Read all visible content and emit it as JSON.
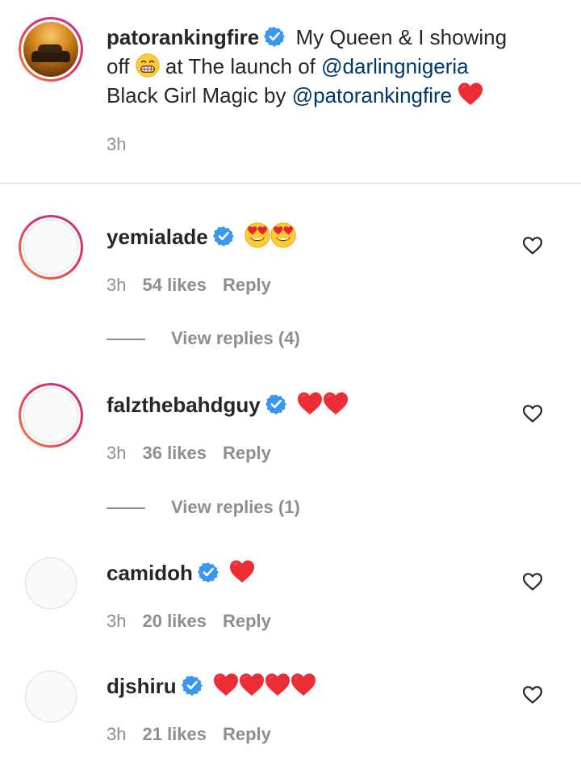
{
  "caption": {
    "username": "patorankingfire",
    "line1_text": "My Queen & I showing",
    "line2_a": "off",
    "line2_b": "at The launch of",
    "mention1": "@darlingnigeria",
    "line3_text": "Black Girl Magic by",
    "mention2": "@patorankingfire",
    "time": "3h"
  },
  "comments": [
    {
      "username": "yemialade",
      "emoji": "heart-eyes x2",
      "time": "3h",
      "likes": "54 likes",
      "reply": "Reply",
      "view_replies": "View replies (4)"
    },
    {
      "username": "falzthebahdguy",
      "emoji": "red-heart x2",
      "time": "3h",
      "likes": "36 likes",
      "reply": "Reply",
      "view_replies": "View replies (1)"
    },
    {
      "username": "camidoh",
      "emoji": "red-heart x1",
      "time": "3h",
      "likes": "20 likes",
      "reply": "Reply"
    },
    {
      "username": "djshiru",
      "emoji": "red-heart x4",
      "time": "3h",
      "likes": "21 likes",
      "reply": "Reply"
    }
  ],
  "colors": {
    "verified": "#3897f0",
    "heart": "#ed2d35",
    "mention": "#00376b",
    "meta": "#8e8e8e"
  }
}
